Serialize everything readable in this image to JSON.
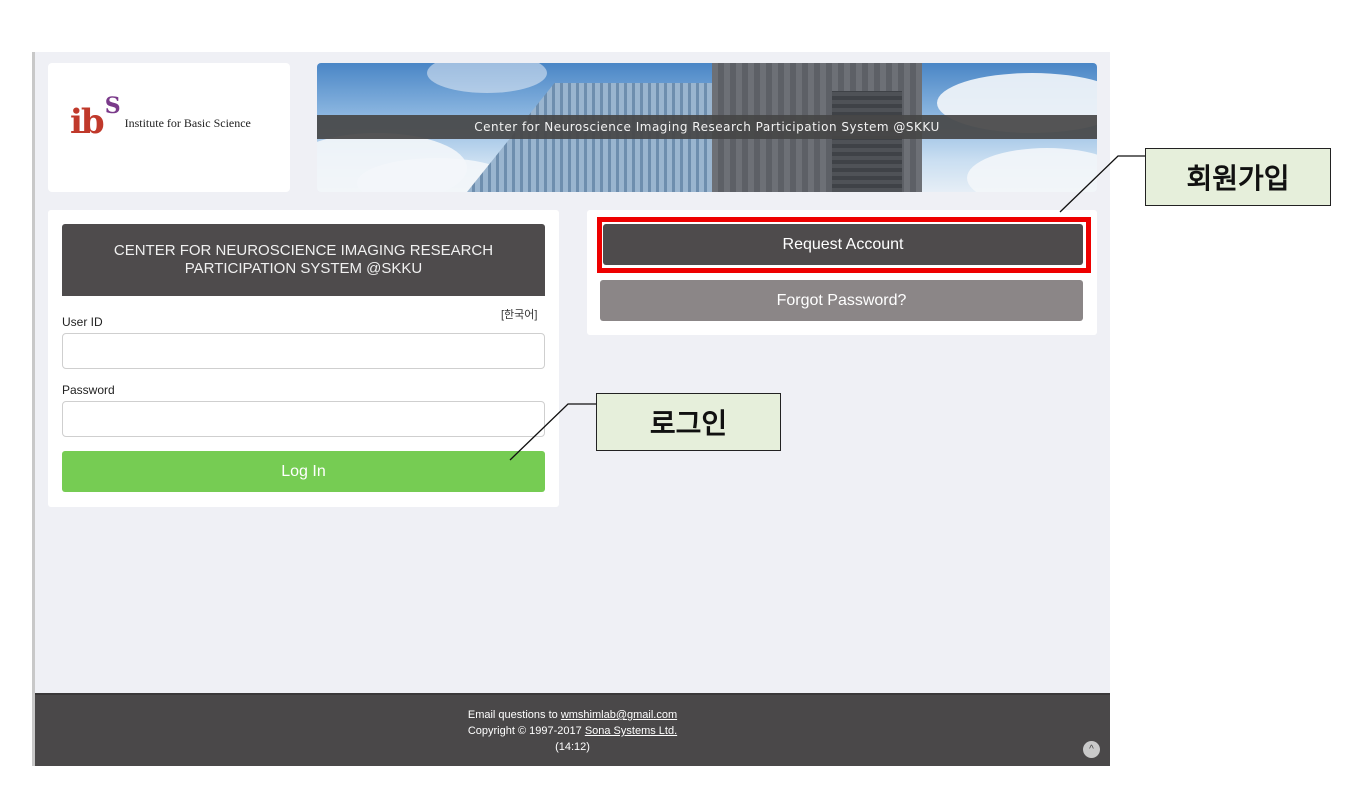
{
  "logo": {
    "mark": "ib",
    "mark_s": "S",
    "text": "Institute for Basic Science"
  },
  "banner": {
    "title": "Center for Neuroscience Imaging Research Participation System @SKKU"
  },
  "login": {
    "header": "CENTER FOR NEUROSCIENCE IMAGING RESEARCH PARTICIPATION SYSTEM @SKKU",
    "language_link": "[한국어]",
    "user_id_label": "User ID",
    "user_id_value": "",
    "password_label": "Password",
    "password_value": "",
    "login_button": "Log In"
  },
  "account": {
    "request_button": "Request Account",
    "forgot_button": "Forgot Password?"
  },
  "footer": {
    "email_prefix": "Email questions to ",
    "email": "wmshimlab@gmail.com",
    "copyright_prefix": "Copyright © 1997-2017 ",
    "company": "Sona Systems Ltd.",
    "time": "(14:12)",
    "scroll_top_glyph": "^"
  },
  "annotations": {
    "signup": "회원가입",
    "login": "로그인"
  },
  "colors": {
    "highlight": "#ee0000",
    "login_button": "#76cc53",
    "dark_button": "#4e4b4c",
    "grey_button": "#8b8687",
    "callout_bg": "#e6efdb"
  }
}
